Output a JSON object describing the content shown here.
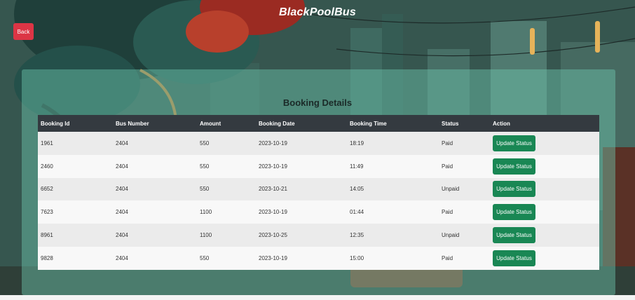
{
  "header": {
    "brand": "BlackPoolBus",
    "back_label": "Back"
  },
  "card": {
    "title": "Booking Details"
  },
  "table": {
    "columns": [
      "Booking Id",
      "Bus Number",
      "Amount",
      "Booking Date",
      "Booking Time",
      "Status",
      "Action"
    ],
    "rows": [
      {
        "booking_id": "1961",
        "bus_number": "2404",
        "amount": "550",
        "date": "2023-10-19",
        "time": "18:19",
        "status": "Paid",
        "action": "Update Status"
      },
      {
        "booking_id": "2460",
        "bus_number": "2404",
        "amount": "550",
        "date": "2023-10-19",
        "time": "11:49",
        "status": "Paid",
        "action": "Update Status"
      },
      {
        "booking_id": "6652",
        "bus_number": "2404",
        "amount": "550",
        "date": "2023-10-21",
        "time": "14:05",
        "status": "Unpaid",
        "action": "Update Status"
      },
      {
        "booking_id": "7623",
        "bus_number": "2404",
        "amount": "1100",
        "date": "2023-10-19",
        "time": "01:44",
        "status": "Paid",
        "action": "Update Status"
      },
      {
        "booking_id": "8961",
        "bus_number": "2404",
        "amount": "1100",
        "date": "2023-10-25",
        "time": "12:35",
        "status": "Unpaid",
        "action": "Update Status"
      },
      {
        "booking_id": "9828",
        "bus_number": "2404",
        "amount": "550",
        "date": "2023-10-19",
        "time": "15:00",
        "status": "Paid",
        "action": "Update Status"
      }
    ]
  },
  "colors": {
    "back_button": "#dc3545",
    "update_button": "#198754",
    "table_header": "#343a40"
  }
}
